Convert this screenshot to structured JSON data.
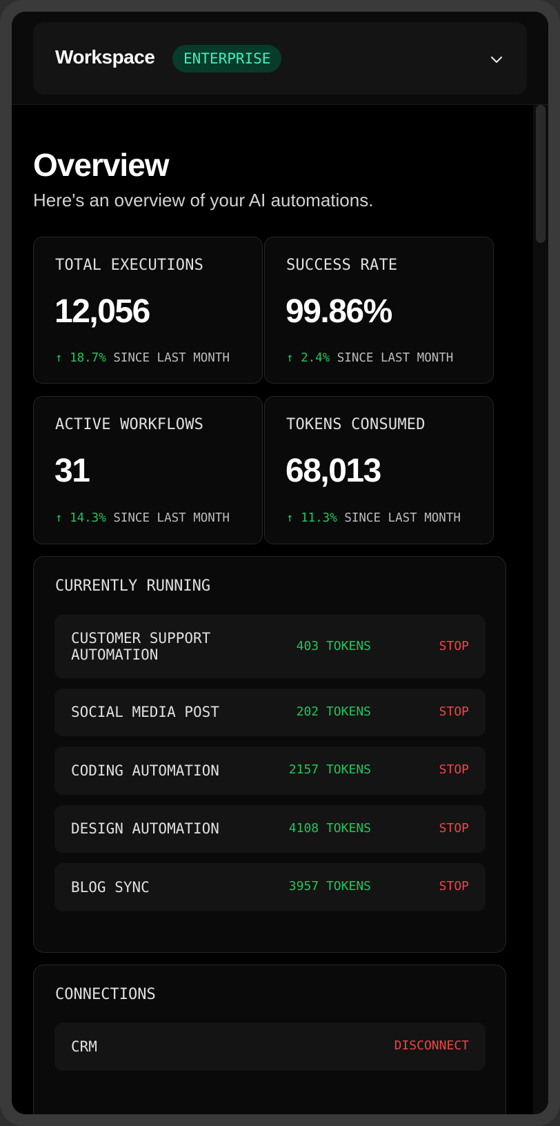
{
  "workspace": {
    "title": "Workspace",
    "plan_badge": "ENTERPRISE"
  },
  "page": {
    "title": "Overview",
    "subtitle": "Here's an overview of your AI automations."
  },
  "stats": [
    {
      "label": "TOTAL EXECUTIONS",
      "value": "12,056",
      "change": "↑ 18.7%",
      "since": "SINCE LAST MONTH"
    },
    {
      "label": "SUCCESS RATE",
      "value": "99.86%",
      "change": "↑ 2.4%",
      "since": "SINCE LAST MONTH"
    },
    {
      "label": "ACTIVE WORKFLOWS",
      "value": "31",
      "change": "↑ 14.3%",
      "since": "SINCE LAST MONTH"
    },
    {
      "label": "TOKENS CONSUMED",
      "value": "68,013",
      "change": "↑ 11.3%",
      "since": "SINCE LAST MONTH"
    }
  ],
  "running": {
    "title": "CURRENTLY RUNNING",
    "items": [
      {
        "name": "CUSTOMER SUPPORT AUTOMATION",
        "tokens": "403 TOKENS",
        "action": "STOP"
      },
      {
        "name": "SOCIAL MEDIA POST",
        "tokens": "202 TOKENS",
        "action": "STOP"
      },
      {
        "name": "CODING AUTOMATION",
        "tokens": "2157 TOKENS",
        "action": "STOP"
      },
      {
        "name": "DESIGN AUTOMATION",
        "tokens": "4108 TOKENS",
        "action": "STOP"
      },
      {
        "name": "BLOG SYNC",
        "tokens": "3957 TOKENS",
        "action": "STOP"
      }
    ]
  },
  "connections": {
    "title": "CONNECTIONS",
    "items": [
      {
        "name": "CRM",
        "action": "DISCONNECT"
      }
    ]
  },
  "colors": {
    "accent_green": "#22c55e",
    "badge_text": "#3ff0b8",
    "badge_bg": "#073b2c",
    "danger_red": "#ef4444",
    "background": "#000000",
    "card": "#0a0a0a"
  },
  "icons": {
    "workspace_toggle": "chevron-down-icon",
    "trend": "arrow-up-icon"
  }
}
